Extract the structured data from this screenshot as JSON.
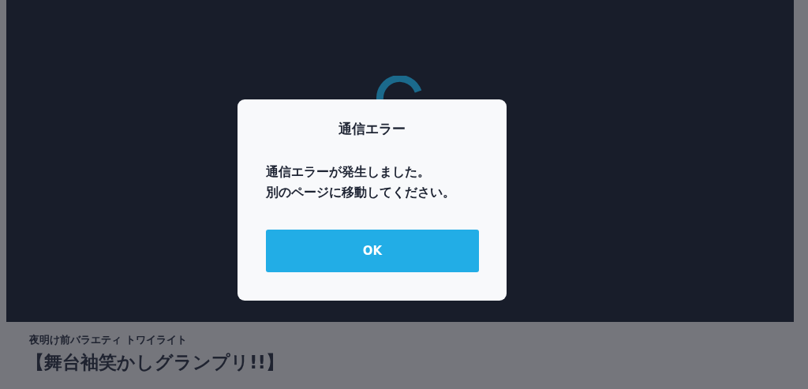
{
  "program": {
    "series": "夜明け前バラエティ トワイライト",
    "title": "【舞台袖笑かしグランプリ!!】"
  },
  "dialog": {
    "title": "通信エラー",
    "message_lines": [
      "通信エラーが発生しました。",
      "別のページに移動してください。"
    ],
    "button": "OK"
  }
}
